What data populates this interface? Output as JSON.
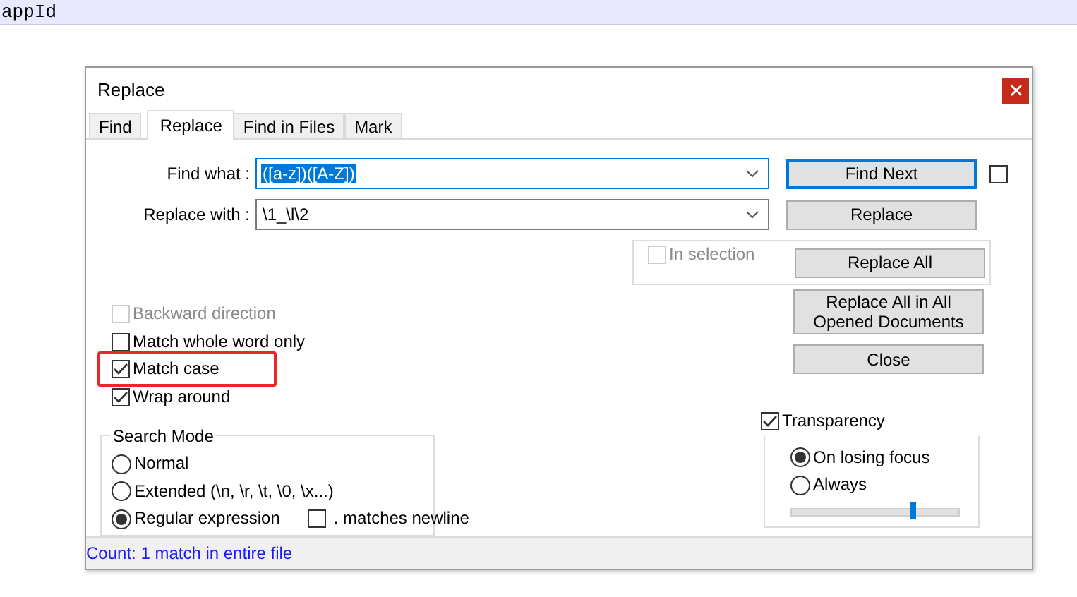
{
  "editor": {
    "line": "appId"
  },
  "dialog": {
    "title": "Replace",
    "tabs": [
      {
        "label": "Find",
        "selected": false
      },
      {
        "label": "Replace",
        "selected": true
      },
      {
        "label": "Find in Files",
        "selected": false
      },
      {
        "label": "Mark",
        "selected": false
      }
    ],
    "find_what": {
      "label": "Find what :",
      "value": "([a-z])([A-Z])",
      "highlighted": true
    },
    "replace_with": {
      "label": "Replace with :",
      "value": "\\1_\\l\\2",
      "highlighted": false
    },
    "find_next": {
      "label": "Find Next",
      "focused": true
    },
    "find_next_option": {
      "checked": false
    },
    "replace": {
      "label": "Replace",
      "focused": false
    },
    "in_selection": {
      "label": "In selection",
      "checked": false,
      "disabled": true
    },
    "replace_all": {
      "label": "Replace All",
      "focused": false
    },
    "replace_all_opened": {
      "label": "Replace All in All Opened Documents",
      "focused": false
    },
    "close": {
      "label": "Close",
      "focused": false
    },
    "options": [
      {
        "label": "Backward direction",
        "checked": false,
        "disabled": true,
        "annotated": false
      },
      {
        "label": "Match whole word only",
        "checked": false,
        "disabled": false,
        "annotated": false
      },
      {
        "label": "Match case",
        "checked": true,
        "disabled": false,
        "annotated": true
      },
      {
        "label": "Wrap around",
        "checked": true,
        "disabled": false,
        "annotated": false
      }
    ],
    "search_mode": {
      "title": "Search Mode",
      "modes": [
        {
          "label": "Normal",
          "selected": false
        },
        {
          "label": "Extended (\\n, \\r, \\t, \\0, \\x...)",
          "selected": false
        },
        {
          "label": "Regular expression",
          "selected": true
        }
      ],
      "dot_matches_newline": {
        "label": ". matches newline",
        "checked": false
      }
    },
    "transparency": {
      "label": "Transparency",
      "checked": true,
      "modes": [
        {
          "label": "On losing focus",
          "selected": true
        },
        {
          "label": "Always",
          "selected": false
        }
      ],
      "level": 0.71
    },
    "status": "Count: 1 match in entire file"
  }
}
